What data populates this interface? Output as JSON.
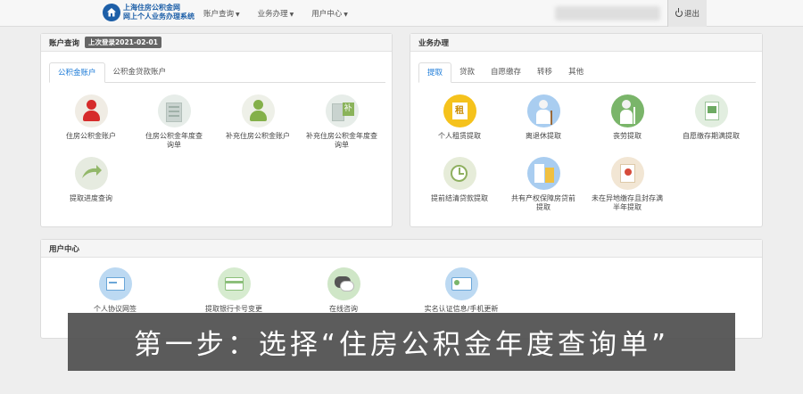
{
  "header": {
    "logo_line1": "上海住房公积金网",
    "logo_line2": "网上个人业务办理系统",
    "menu": [
      {
        "label": "账户查询"
      },
      {
        "label": "业务办理"
      },
      {
        "label": "用户中心"
      }
    ],
    "logout_label": "退出"
  },
  "account_panel": {
    "title": "账户查询",
    "last_login": "上次登录2021-02-01",
    "tabs": [
      "公积金账户",
      "公积金贷款账户"
    ],
    "items": [
      {
        "label": "住房公积金账户",
        "icon": "person-red-icon"
      },
      {
        "label": "住房公积金年度查询单",
        "icon": "building-icon"
      },
      {
        "label": "补充住房公积金账户",
        "icon": "person-green-icon"
      },
      {
        "label": "补充住房公积金年度查询单",
        "icon": "building-supplement-icon"
      },
      {
        "label": "提取进度查询",
        "icon": "progress-arrow-icon"
      }
    ]
  },
  "business_panel": {
    "title": "业务办理",
    "tabs": [
      "提取",
      "贷款",
      "自愿缴存",
      "转移",
      "其他"
    ],
    "items": [
      {
        "label": "个人租赁提取",
        "icon": "rent-icon"
      },
      {
        "label": "离退休提取",
        "icon": "retire-icon"
      },
      {
        "label": "丧劳提取",
        "icon": "disabled-icon"
      },
      {
        "label": "自愿缴存期满提取",
        "icon": "document-green-icon"
      },
      {
        "label": "提前结清贷款提取",
        "icon": "clock-doc-icon"
      },
      {
        "label": "共有产权保障房贷前提取",
        "icon": "shared-property-icon"
      },
      {
        "label": "未在异地缴存且封存满半年提取",
        "icon": "sealed-doc-icon"
      }
    ]
  },
  "user_panel": {
    "title": "用户中心",
    "items": [
      {
        "label": "个人协议网签",
        "icon": "agreement-icon"
      },
      {
        "label": "提取银行卡号变更",
        "icon": "bank-card-icon"
      },
      {
        "label": "在线咨询",
        "icon": "chat-icon"
      },
      {
        "label": "实名认证信息/手机更新",
        "icon": "id-card-icon"
      }
    ]
  },
  "overlay": {
    "caption": "第一步：选择“住房公积金年度查询单”"
  },
  "colors": {
    "accent": "#1d7bd8",
    "logo": "#1d5fa8",
    "overlay_bg": "#505050"
  }
}
